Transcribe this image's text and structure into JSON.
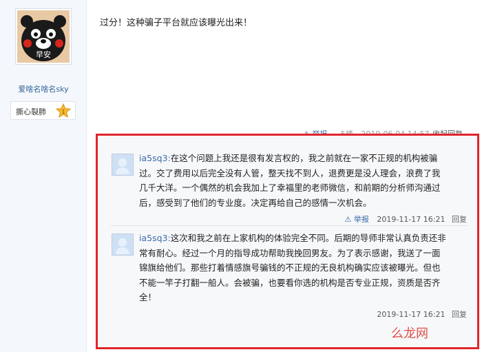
{
  "author": {
    "avatar_caption": "早安",
    "name": "爱啥名啥名sky",
    "rank_label": "撕心裂肺",
    "rank_level": "1"
  },
  "post": {
    "text": "过分！这种骗子平台就应该曝光出来！",
    "report_label": "举报",
    "floor": "5楼",
    "date": "2019-06-04 14:57",
    "collapse_label": "收起回复"
  },
  "replies": [
    {
      "user": "ia5sq3:",
      "lines": [
        "在这个问题上我还是很有发言权的，我之前就在一家不正规的机构被骗",
        "过。交了费用以后完全没有人管，整天找不到人，退费更是没人理会，浪费了我",
        "几千大洋。一个偶然的机会我加上了幸福里的老师微信，和前期的分析师沟通过",
        "后，感受到了他们的专业度。决定再给自己的感情一次机会。"
      ],
      "report_label": "举报",
      "time": "2019-11-17 16:21",
      "reply_label": "回复"
    },
    {
      "user": "ia5sq3:",
      "lines": [
        "这次和我之前在上家机构的体验完全不同。后期的导师非常认真负责还非",
        "常有耐心。经过一个月的指导成功帮助我挽回男友。为了表示感谢，我送了一面",
        "锦旗给他们。那些打着情感旗号骗钱的不正规的无良机构确实应该被曝光。但也",
        "不能一竿子打翻一船人。会被骗，也要看你选的机构是否专业正规，资质是否齐",
        "全！"
      ],
      "time": "2019-11-17 16:21",
      "reply_label": "回复"
    }
  ],
  "watermark": "么龙网",
  "colors": {
    "highlight_border": "#e0252b",
    "link": "#3a6aa8"
  }
}
